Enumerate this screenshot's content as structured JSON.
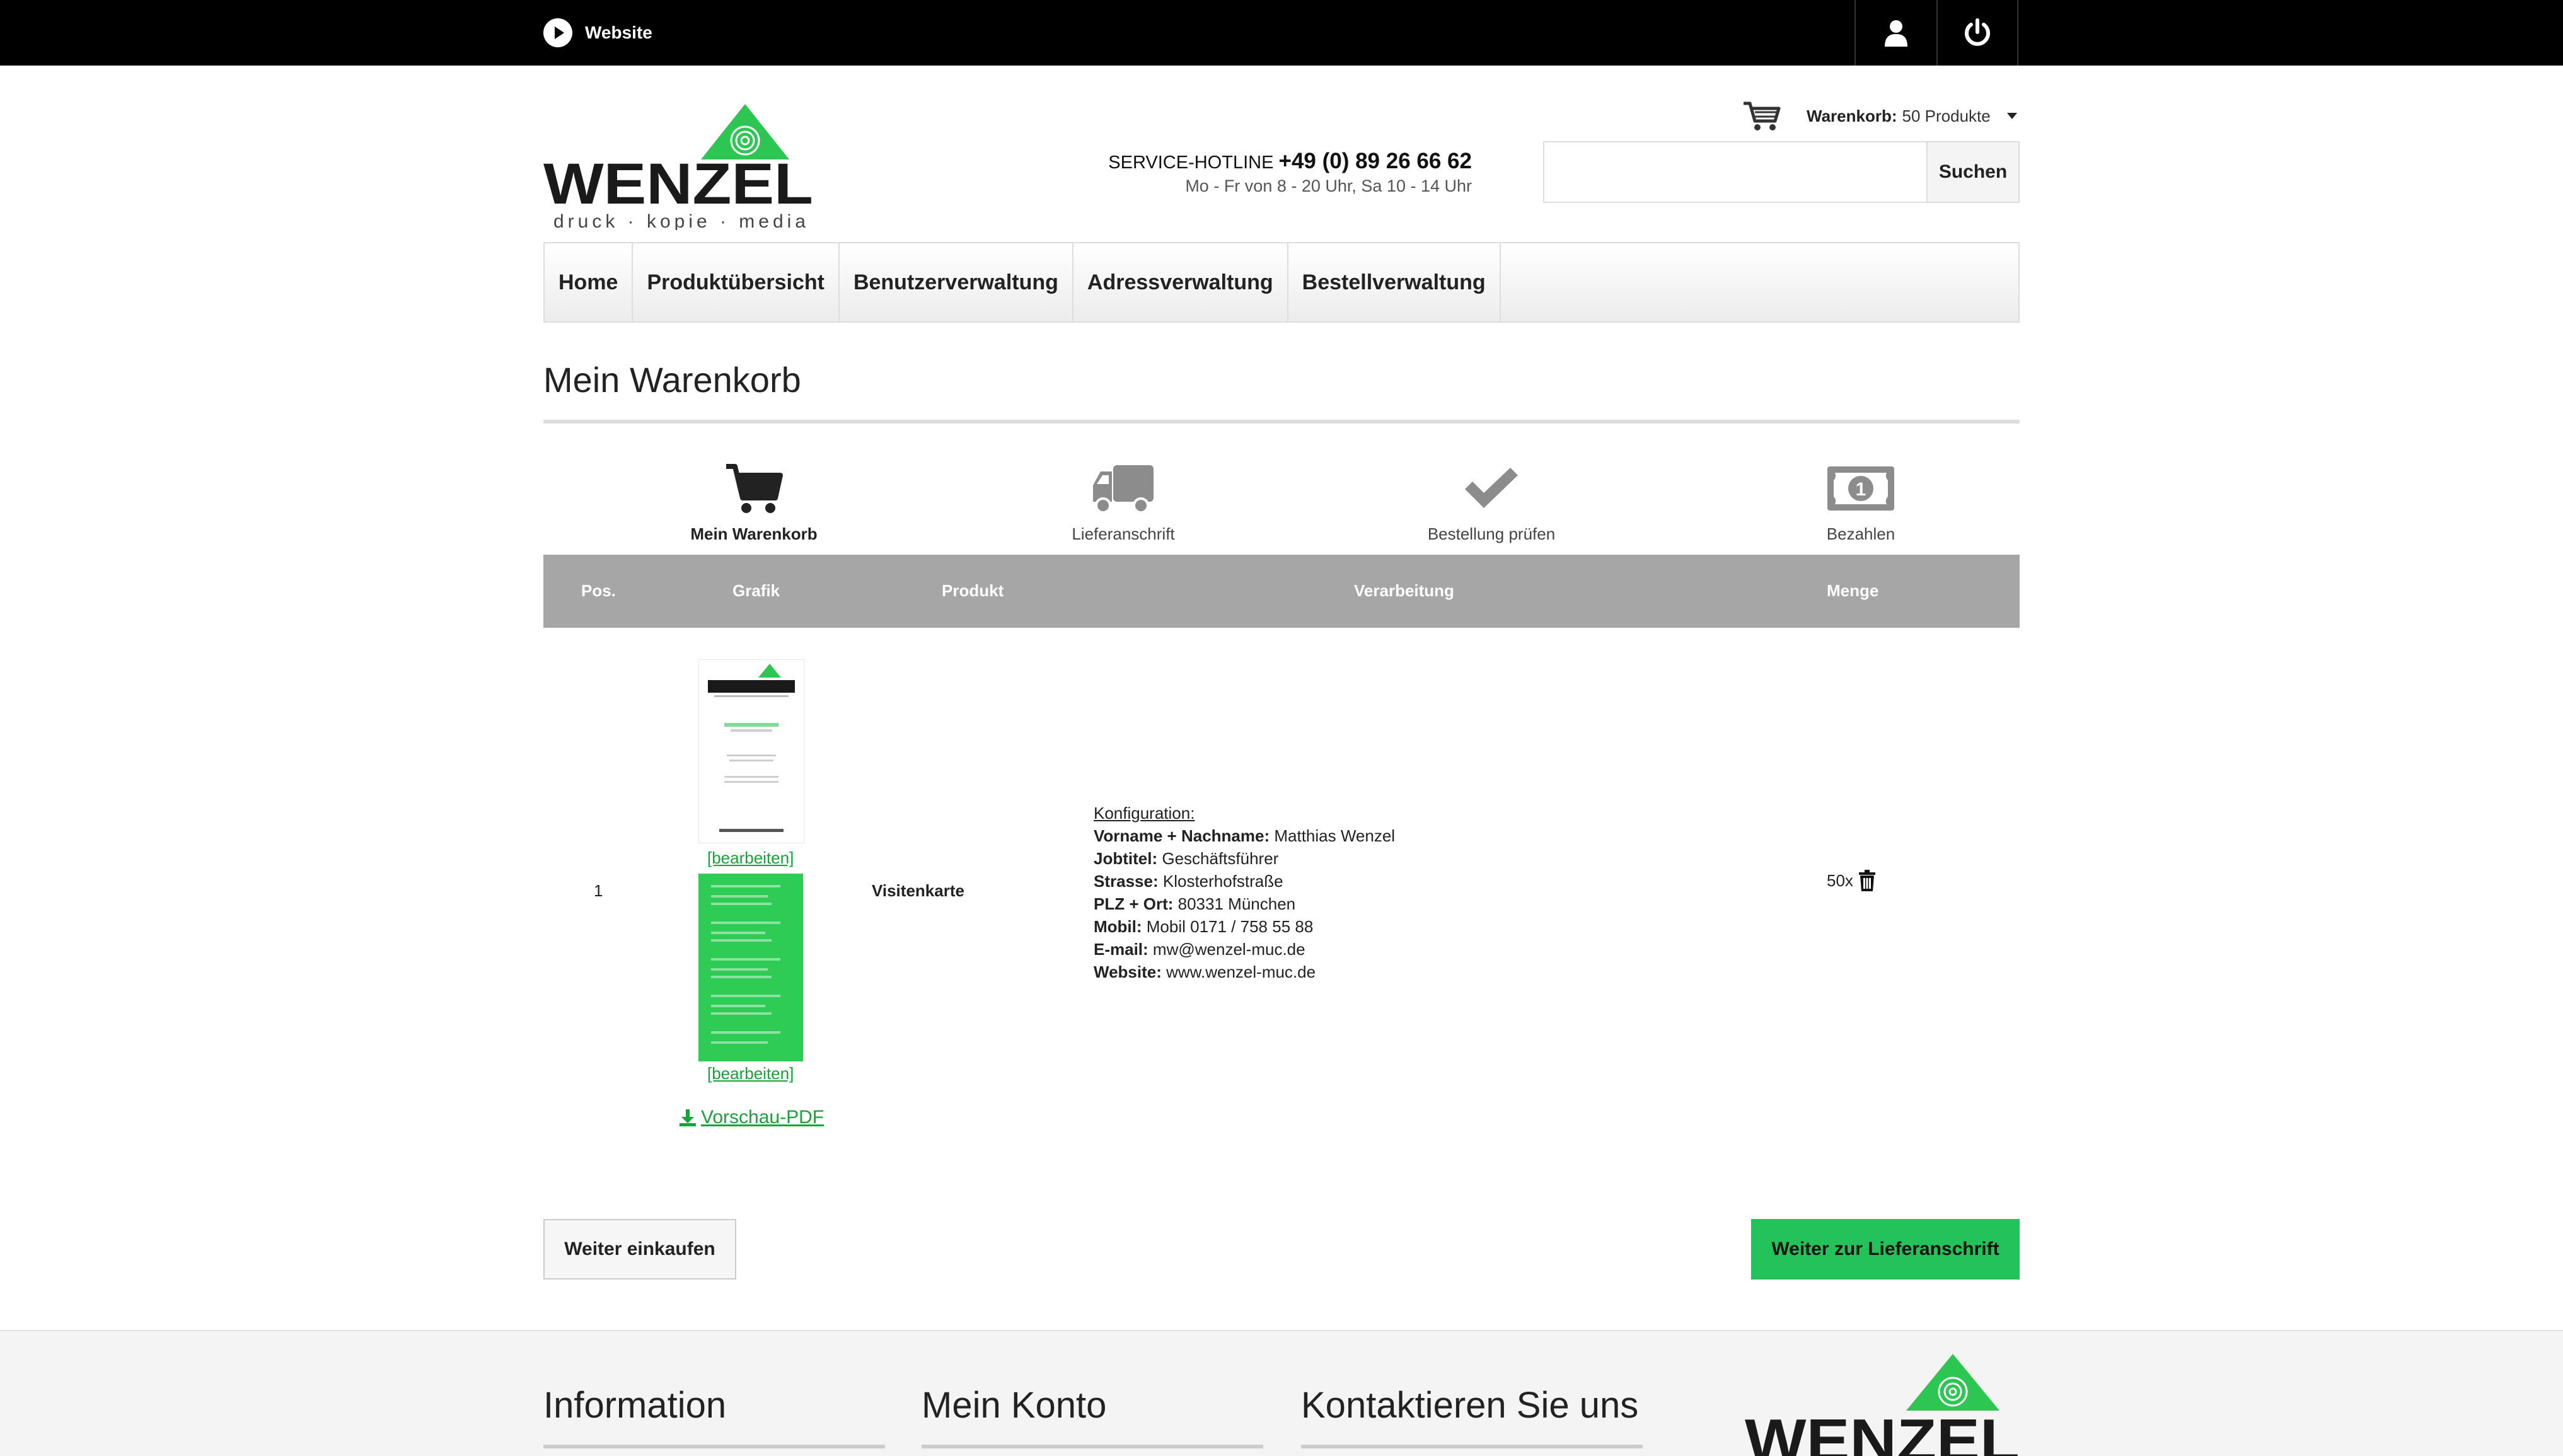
{
  "topbar": {
    "website_label": "Website"
  },
  "header": {
    "logo": {
      "brand": "WENZEL",
      "tagline": "druck · kopie · media"
    },
    "hotline": {
      "label": "SERVICE-HOTLINE",
      "number": "+49 (0) 89 26 66 62",
      "hours": "Mo - Fr von 8 - 20 Uhr, Sa 10 - 14 Uhr"
    },
    "cart": {
      "label": "Warenkorb:",
      "count": "50 Produkte"
    },
    "search": {
      "placeholder": "",
      "button": "Suchen"
    }
  },
  "nav": [
    "Home",
    "Produktübersicht",
    "Benutzerverwaltung",
    "Adressverwaltung",
    "Bestellverwaltung"
  ],
  "page": {
    "title": "Mein Warenkorb"
  },
  "steps": [
    {
      "label": "Mein Warenkorb",
      "icon": "cart-icon",
      "active": true
    },
    {
      "label": "Lieferanschrift",
      "icon": "truck-icon",
      "active": false
    },
    {
      "label": "Bestellung prüfen",
      "icon": "checkmark-icon",
      "active": false
    },
    {
      "label": "Bezahlen",
      "icon": "banknote-icon",
      "active": false
    }
  ],
  "table": {
    "headers": {
      "pos": "Pos.",
      "grafik": "Grafik",
      "produkt": "Produkt",
      "verarbeitung": "Verarbeitung",
      "menge": "Menge"
    },
    "rows": [
      {
        "pos": "1",
        "product": "Visitenkarte",
        "edit_front": "[bearbeiten]",
        "edit_back": "[bearbeiten]",
        "pdf_link": "Vorschau-PDF",
        "config_heading": "Konfiguration:",
        "config": [
          {
            "key": "Vorname + Nachname:",
            "value": "Matthias Wenzel"
          },
          {
            "key": "Jobtitel:",
            "value": "Geschäftsführer"
          },
          {
            "key": "Strasse:",
            "value": "Klosterhofstraße"
          },
          {
            "key": "PLZ + Ort:",
            "value": "80331 München"
          },
          {
            "key": "Mobil:",
            "value": "Mobil 0171 / 758 55 88"
          },
          {
            "key": "E-mail:",
            "value": "mw@wenzel-muc.de"
          },
          {
            "key": "Website:",
            "value": "www.wenzel-muc.de"
          }
        ],
        "quantity": "50x"
      }
    ]
  },
  "actions": {
    "continue_shopping": "Weiter einkaufen",
    "next": "Weiter zur Lieferanschrift"
  },
  "footer": {
    "col1": "Information",
    "col2": "Mein Konto",
    "col3": "Kontaktieren Sie uns"
  },
  "colors": {
    "brand_green": "#23c25a",
    "link_green": "#17a23a",
    "table_header": "#a6a6a6",
    "topbar": "#000000"
  }
}
